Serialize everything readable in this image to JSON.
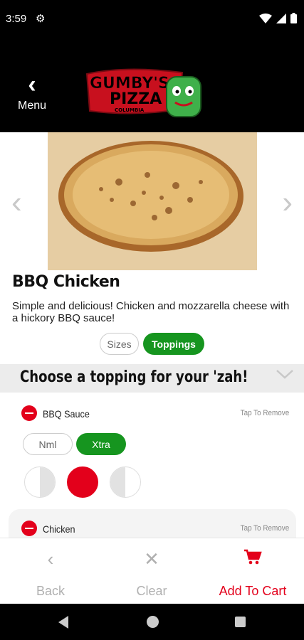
{
  "status_bar": {
    "time": "3:59"
  },
  "header": {
    "back_label": "Menu",
    "logo": {
      "line1": "GUMBY'S",
      "line2": "PIZZA",
      "line3": "COLUMBIA"
    }
  },
  "product": {
    "title": "BBQ Chicken",
    "description": "Simple and delicious!  Chicken and mozzarella cheese with a hickory BBQ sauce!"
  },
  "tabs": [
    {
      "label": "Sizes",
      "active": false
    },
    {
      "label": "Toppings",
      "active": true
    }
  ],
  "section": {
    "title": "Choose a topping for your 'zah!"
  },
  "toppings": [
    {
      "name": "BBQ Sauce",
      "action": "Tap To Remove",
      "amounts": [
        {
          "label": "Nml",
          "selected": false
        },
        {
          "label": "Xtra",
          "selected": true
        }
      ],
      "portion_selected": "whole"
    },
    {
      "name": "Chicken",
      "action": "Tap To Remove"
    }
  ],
  "actions": {
    "back": "Back",
    "clear": "Clear",
    "add_to_cart": "Add To Cart"
  },
  "colors": {
    "accent_green": "#16951f",
    "brand_red": "#e3001b"
  }
}
